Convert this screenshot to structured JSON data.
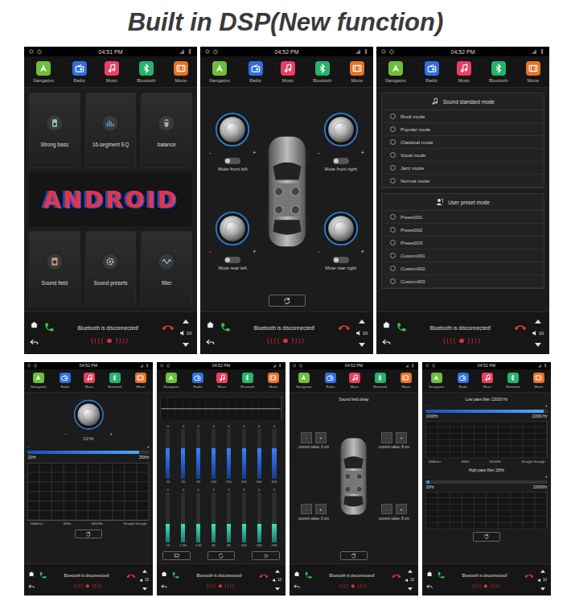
{
  "title": "Built in DSP(New function)",
  "apps": [
    {
      "label": "Navigation",
      "color": "#6cbf3a"
    },
    {
      "label": "Radio",
      "color": "#2f6fe0"
    },
    {
      "label": "Music",
      "color": "#e8405e"
    },
    {
      "label": "Bluetooth",
      "color": "#27b36b"
    },
    {
      "label": "Movie",
      "color": "#e5732a"
    }
  ],
  "bottom_bar": {
    "status": "Bluetooth is disconnected!",
    "volume": "10"
  },
  "screens": [
    {
      "kind": "menu",
      "time": "04:51 PM",
      "tiles_top": [
        "Strong bass",
        "16-segment EQ",
        "balance"
      ],
      "banner": "ANDROID",
      "tiles_bottom": [
        "Sound field",
        "Sound presets",
        "filter"
      ]
    },
    {
      "kind": "balance",
      "time": "04:52 PM",
      "minus": "-",
      "plus": "+",
      "speakers": [
        {
          "label": "Mute front left",
          "on": false
        },
        {
          "label": "Mute front right",
          "on": false
        },
        {
          "label": "Mute rear left",
          "on": false
        },
        {
          "label": "Mute rear right",
          "on": false
        }
      ]
    },
    {
      "kind": "presets",
      "time": "04:52 PM",
      "standard": {
        "title": "Sound standard mode",
        "modes": [
          {
            "label": "Rock mode",
            "selected": false
          },
          {
            "label": "Popular mode",
            "selected": false
          },
          {
            "label": "Classical mode",
            "selected": false
          },
          {
            "label": "Vocal mode",
            "selected": false
          },
          {
            "label": "Jazz mode",
            "selected": false
          },
          {
            "label": "Normal mode",
            "selected": false
          }
        ]
      },
      "user": {
        "title": "User preset mode",
        "modes": [
          {
            "label": "Preset001",
            "selected": false
          },
          {
            "label": "Preset002",
            "selected": false
          },
          {
            "label": "Preset003",
            "selected": false
          },
          {
            "label": "Custom001",
            "selected": false
          },
          {
            "label": "Custom002",
            "selected": false
          },
          {
            "label": "Custom003",
            "selected": false
          }
        ]
      }
    },
    {
      "kind": "bass",
      "time": "04:52 PM",
      "knob_reading": "3.0 Hz",
      "minus": "-",
      "plus": "+",
      "slider": {
        "min": "20Hz",
        "max": "250Hz",
        "level": 0.92
      },
      "graph_labels": [
        "16db/oct",
        "80Hz",
        "6000Hz",
        "Straight through"
      ]
    },
    {
      "kind": "eq",
      "time": "04:52 PM",
      "curve": [
        0,
        0,
        0,
        0,
        0,
        0,
        0,
        0,
        0,
        0,
        0,
        0,
        0,
        0,
        0,
        0
      ],
      "bands": [
        {
          "value": "0",
          "freq": "20",
          "level": 0.62
        },
        {
          "value": "0",
          "freq": "40",
          "level": 0.62
        },
        {
          "value": "0",
          "freq": "60",
          "level": 0.62
        },
        {
          "value": "0",
          "freq": "100",
          "level": 0.62
        },
        {
          "value": "0",
          "freq": "150",
          "level": 0.62
        },
        {
          "value": "0",
          "freq": "250",
          "level": 0.62
        },
        {
          "value": "0",
          "freq": "400",
          "level": 0.62
        },
        {
          "value": "0",
          "freq": "600",
          "level": 0.62
        },
        {
          "value": "0",
          "freq": "1K",
          "level": 0.38
        },
        {
          "value": "0",
          "freq": "1.5K",
          "level": 0.38
        },
        {
          "value": "0",
          "freq": "2.5K",
          "level": 0.38
        },
        {
          "value": "0",
          "freq": "4K",
          "level": 0.38
        },
        {
          "value": "0",
          "freq": "6K",
          "level": 0.38
        },
        {
          "value": "0",
          "freq": "10K",
          "level": 0.38
        },
        {
          "value": "0",
          "freq": "15K",
          "level": 0.38
        },
        {
          "value": "0",
          "freq": "20K",
          "level": 0.38
        }
      ]
    },
    {
      "kind": "delay",
      "time": "04:52 PM",
      "title": "Sound field delay",
      "minus": "-",
      "plus": "+",
      "corners": [
        {
          "reading": "current value: 0 cm"
        },
        {
          "reading": "current value: 8 cm"
        },
        {
          "reading": "current value: 0 cm"
        },
        {
          "reading": "current value: 8 cm"
        }
      ]
    },
    {
      "kind": "filter",
      "time": "04:52 PM",
      "minus": "-",
      "plus": "+",
      "filters": [
        {
          "title": "Low pass filter 22000 Hz",
          "min": "1000Hz",
          "max": "22000 Hz",
          "level": 0.97,
          "labels": [
            "16db/oct",
            "80Hz",
            "6000Hz",
            "Straight through"
          ]
        },
        {
          "title": "High pass filter 20Hz",
          "min": "20Hz",
          "max": "22000Hz",
          "level": 0.03,
          "labels": []
        }
      ]
    }
  ]
}
